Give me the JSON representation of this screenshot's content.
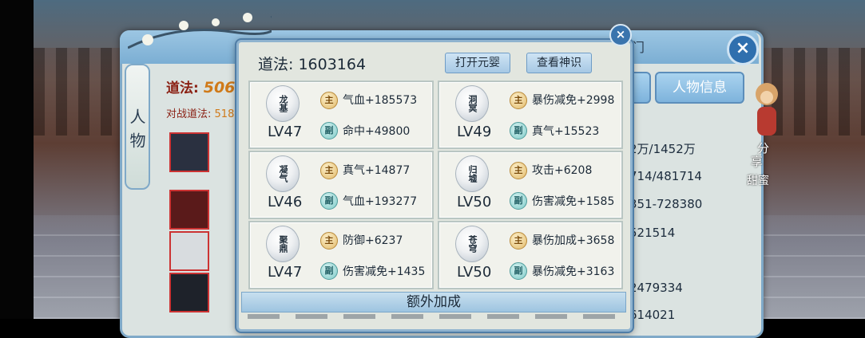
{
  "background": {
    "side_tab_label": "人物",
    "daofa_label": "道法:",
    "daofa_value": "506",
    "battle_label": "对战道法:",
    "battle_value": "518",
    "top_tab": "奇门",
    "info_button": "人物信息",
    "stats": [
      "2万/1452万",
      "714/481714",
      "351-728380",
      "521514",
      "2479334",
      "614021"
    ],
    "share_line1": "分",
    "share_line2": "享",
    "share_line3": "甜蜜"
  },
  "popup": {
    "dao_label": "道法: 1603164",
    "open_button": "打开元婴",
    "view_button": "查看神识",
    "main_badge": "主",
    "sub_badge": "副",
    "cards": [
      {
        "gem": "龙基",
        "level": "LV47",
        "main": "气血+185573",
        "sub": "命中+49800"
      },
      {
        "gem": "洞冥",
        "level": "LV49",
        "main": "暴伤减免+2998",
        "sub": "真气+15523"
      },
      {
        "gem": "凝气",
        "level": "LV46",
        "main": "真气+14877",
        "sub": "气血+193277"
      },
      {
        "gem": "归墟",
        "level": "LV50",
        "main": "攻击+6208",
        "sub": "伤害减免+1585"
      },
      {
        "gem": "聚鼎",
        "level": "LV47",
        "main": "防御+6237",
        "sub": "伤害减免+1435"
      },
      {
        "gem": "苍穹",
        "level": "LV50",
        "main": "暴伤加成+3658",
        "sub": "暴伤减免+3163"
      }
    ],
    "extra_title": "额外加成"
  },
  "colors": {
    "accent": "#7fa9c8",
    "title_red": "#8a1f12",
    "value_orange": "#d07a19"
  }
}
